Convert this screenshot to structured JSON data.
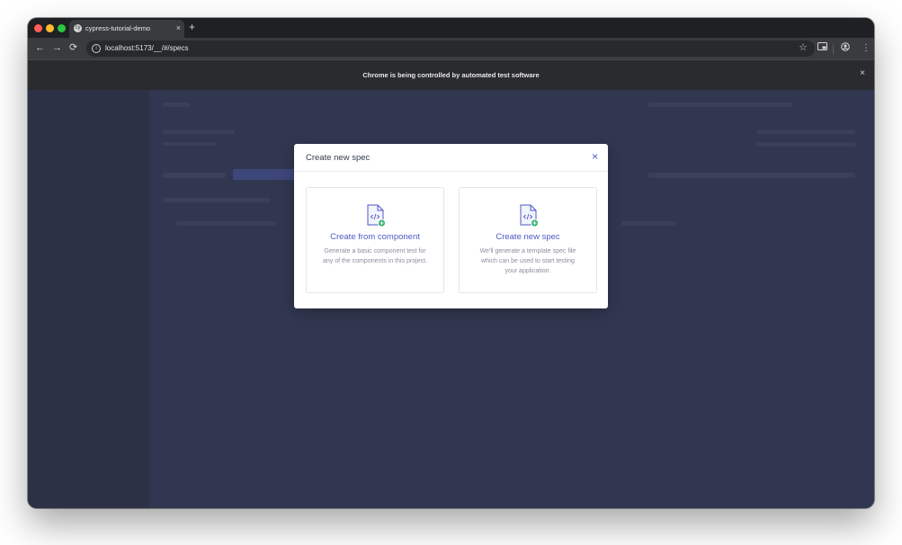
{
  "browser": {
    "tab_title": "cypress-tutorial-demo",
    "tab_close": "×",
    "new_tab": "+",
    "back": "←",
    "forward": "→",
    "reload": "⟳",
    "url": "localhost:5173/__/#/specs",
    "bookmark": "☆",
    "menu": "⋮",
    "infobar_text": "Chrome is being controlled by automated test software",
    "infobar_close": "×"
  },
  "modal": {
    "title": "Create new spec",
    "close": "×",
    "options": [
      {
        "title": "Create from component",
        "description": "Generate a basic component test for any of the components in this project."
      },
      {
        "title": "Create new spec",
        "description": "We'll generate a template spec file which can be used to start testing your application."
      }
    ]
  },
  "colors": {
    "accent": "#4f58c4",
    "badge_green": "#2fb36e",
    "backdrop": "#313750"
  }
}
